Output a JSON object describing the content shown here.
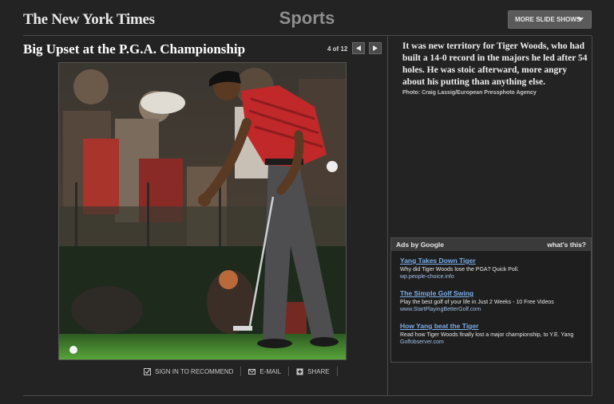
{
  "header": {
    "logo": "The New York Times",
    "section": "Sports",
    "more_button": "MORE SLIDE SHOWS"
  },
  "slideshow": {
    "title": "Big Upset at the P.G.A. Championship",
    "counter": "4 of 12",
    "caption": "It was new territory for Tiger Woods, who had built a 14-0 record in the majors he led after 54 holes. He was stoic afterward, more angry about his putting than anything else.",
    "credit": "Photo: Craig Lassig/European Pressphoto Agency"
  },
  "actions": {
    "recommend": "SIGN IN TO RECOMMEND",
    "email": "E-MAIL",
    "share": "SHARE"
  },
  "ads": {
    "label": "Ads by Google",
    "whats_this": "what's this?",
    "items": [
      {
        "title": "Yang Takes Down Tiger",
        "text": "Why did Tiger Woods lose the PGA? Quick Poll.",
        "url": "wp.people-choice.info"
      },
      {
        "title": "The Simple Golf Swing",
        "text": "Play the best golf of your life in Just 2 Weeks - 10 Free Videos",
        "url": "www.StartPlayingBetterGolf.com"
      },
      {
        "title": "How Yang beat the Tiger",
        "text": "Read how Tiger Woods finally lost a major championship, to Y.E. Yang",
        "url": "Golfobserver.com"
      }
    ]
  },
  "colors": {
    "background": "#232323",
    "ad_link": "#7aaeea",
    "shirt": "#c0282a"
  }
}
